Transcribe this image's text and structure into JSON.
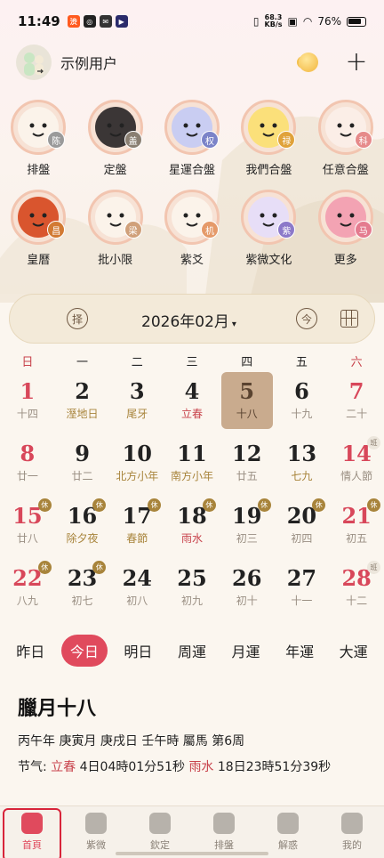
{
  "status_bar": {
    "time": "11:49",
    "net_speed_value": "68.3",
    "net_speed_unit": "KB/s",
    "battery": "76%"
  },
  "header": {
    "user_name": "示例用户"
  },
  "features": [
    {
      "label": "排盤",
      "badge": "陈",
      "badge_color": "#9a9a9a",
      "face_color": "#fbf3ea"
    },
    {
      "label": "定盤",
      "badge": "盖",
      "badge_color": "#8a7f72",
      "face_color": "#3b3636"
    },
    {
      "label": "星運合盤",
      "badge": "权",
      "badge_color": "#7b83c8",
      "face_color": "#c9cdf2"
    },
    {
      "label": "我們合盤",
      "badge": "禄",
      "badge_color": "#e0a23a",
      "face_color": "#fbe07a"
    },
    {
      "label": "任意合盤",
      "badge": "科",
      "badge_color": "#e68a8a",
      "face_color": "#fbeee7"
    },
    {
      "label": "皇曆",
      "badge": "昌",
      "badge_color": "#d27a33",
      "face_color": "#d9552e"
    },
    {
      "label": "批小限",
      "badge": "梁",
      "badge_color": "#d0a07a",
      "face_color": "#fbf3ea"
    },
    {
      "label": "紫爻",
      "badge": "机",
      "badge_color": "#e59a6a",
      "face_color": "#fbf3ea"
    },
    {
      "label": "紫微文化",
      "badge": "紫",
      "badge_color": "#8c79c9",
      "face_color": "#e7def7"
    },
    {
      "label": "更多",
      "badge": "马",
      "badge_color": "#e47b8f",
      "face_color": "#f3a3b3"
    }
  ],
  "calendar": {
    "select_button": "择",
    "month_label": "2026年02月",
    "caret": "▾",
    "today_button": "今",
    "weekdays": [
      "日",
      "一",
      "二",
      "三",
      "四",
      "五",
      "六"
    ],
    "days": [
      {
        "num": "1",
        "sub": "十四",
        "weekend": true
      },
      {
        "num": "2",
        "sub": "溼地日",
        "type": "holiday"
      },
      {
        "num": "3",
        "sub": "尾牙",
        "type": "holiday"
      },
      {
        "num": "4",
        "sub": "立春",
        "type": "term"
      },
      {
        "num": "5",
        "sub": "十八",
        "selected": true
      },
      {
        "num": "6",
        "sub": "十九"
      },
      {
        "num": "7",
        "sub": "二十",
        "weekend": true
      },
      {
        "num": "8",
        "sub": "廿一",
        "weekend": true
      },
      {
        "num": "9",
        "sub": "廿二"
      },
      {
        "num": "10",
        "sub": "北方小年",
        "type": "holiday"
      },
      {
        "num": "11",
        "sub": "南方小年",
        "type": "holiday"
      },
      {
        "num": "12",
        "sub": "廿五"
      },
      {
        "num": "13",
        "sub": "七九",
        "type": "holiday"
      },
      {
        "num": "14",
        "sub": "情人節",
        "type": "holiday",
        "weekend": true,
        "badge": "班",
        "badge_type": "work"
      },
      {
        "num": "15",
        "sub": "廿八",
        "weekend": true,
        "badge": "休"
      },
      {
        "num": "16",
        "sub": "除夕夜",
        "type": "holiday",
        "badge": "休"
      },
      {
        "num": "17",
        "sub": "春節",
        "type": "holiday",
        "badge": "休"
      },
      {
        "num": "18",
        "sub": "雨水",
        "type": "term",
        "badge": "休"
      },
      {
        "num": "19",
        "sub": "初三",
        "badge": "休"
      },
      {
        "num": "20",
        "sub": "初四",
        "badge": "休"
      },
      {
        "num": "21",
        "sub": "初五",
        "weekend": true,
        "badge": "休"
      },
      {
        "num": "22",
        "sub": "八九",
        "weekend": true,
        "badge": "休"
      },
      {
        "num": "23",
        "sub": "初七",
        "badge": "休"
      },
      {
        "num": "24",
        "sub": "初八"
      },
      {
        "num": "25",
        "sub": "初九"
      },
      {
        "num": "26",
        "sub": "初十"
      },
      {
        "num": "27",
        "sub": "十一"
      },
      {
        "num": "28",
        "sub": "十二",
        "weekend": true,
        "badge": "班",
        "badge_type": "work"
      }
    ]
  },
  "range_tabs": [
    {
      "label": "昨日"
    },
    {
      "label": "今日",
      "active": true
    },
    {
      "label": "明日"
    },
    {
      "label": "周運"
    },
    {
      "label": "月運"
    },
    {
      "label": "年運"
    },
    {
      "label": "大運"
    }
  ],
  "day_info": {
    "lunar_date": "臘月十八",
    "ganzhi": "丙午年 庚寅月 庚戌日 壬午時 屬馬 第6周",
    "jieqi_prefix": "节气:",
    "term1_name": "立春",
    "term1_time": "4日04時01分51秒",
    "term2_name": "雨水",
    "term2_time": "18日23時51分39秒"
  },
  "bottom_nav": [
    {
      "label": "首頁",
      "active": true
    },
    {
      "label": "紫微"
    },
    {
      "label": "欽定"
    },
    {
      "label": "排盤"
    },
    {
      "label": "解惑"
    },
    {
      "label": "我的"
    }
  ]
}
